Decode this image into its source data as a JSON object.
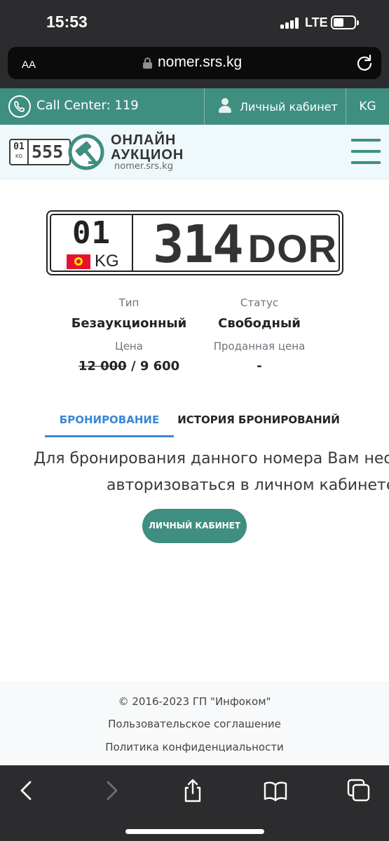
{
  "status_bar": {
    "time": "15:53",
    "network": "LTE"
  },
  "browser": {
    "aa_label": "AA",
    "url": "nomer.srs.kg",
    "toolbar_icons": [
      "back-icon",
      "forward-icon",
      "share-icon",
      "bookmarks-icon",
      "tabs-icon"
    ]
  },
  "header": {
    "call_center": "Call Center: 119",
    "cabinet_link": "Личный кабинет",
    "language": "KG",
    "logo": {
      "plate_region": "01",
      "plate_country": "KG",
      "plate_number": "555",
      "title_line1": "ОНЛАЙН",
      "title_line2": "АУКЦИОН",
      "subtitle": "nomer.srs.kg"
    }
  },
  "plate": {
    "region": "01",
    "country": "KG",
    "digits": "314",
    "letters": "DOR"
  },
  "info": {
    "type_label": "Тип",
    "type_value": "Безаукционный",
    "status_label": "Статус",
    "status_value": "Свободный",
    "price_label": "Цена",
    "price_old": "12 000",
    "price_separator": " / ",
    "price_new": "9 600",
    "sold_price_label": "Проданная цена",
    "sold_price_value": "-"
  },
  "tabs": {
    "booking": "БРОНИРОВАНИЕ",
    "history": "ИСТОРИЯ БРОНИРОВАНИЙ",
    "active": "booking"
  },
  "notice": {
    "line1": "Для бронирования данного номера Вам необ",
    "line2": "авторизоваться в личном кабинете"
  },
  "cabinet_button": "ЛИЧНЫЙ КАБИНЕТ",
  "footer": {
    "copyright": "© 2016-2023 ГП \"Инфоком\"",
    "agreement": "Пользовательское соглашение",
    "privacy": "Политика конфиденциальности"
  },
  "colors": {
    "brand_green": "#3f8f80",
    "tab_active": "#3b86d6",
    "logo_bg": "#eff8fa"
  }
}
